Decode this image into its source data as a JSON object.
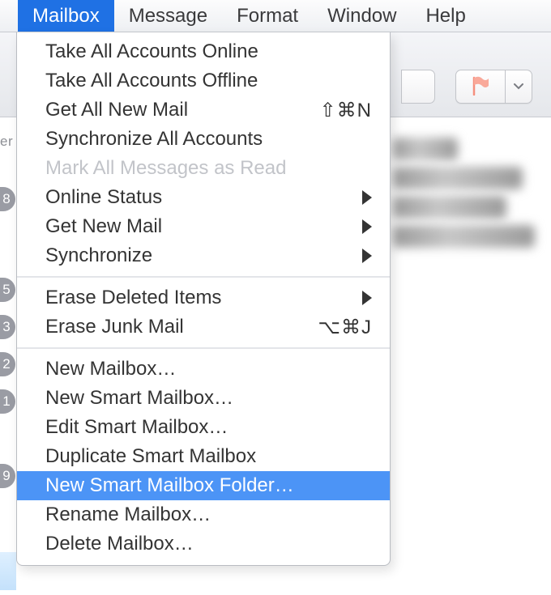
{
  "menubar": {
    "items": [
      {
        "label": "Mailbox",
        "active": true
      },
      {
        "label": "Message",
        "active": false
      },
      {
        "label": "Format",
        "active": false
      },
      {
        "label": "Window",
        "active": false
      },
      {
        "label": "Help",
        "active": false
      }
    ]
  },
  "dropdown": {
    "items": [
      {
        "type": "item",
        "label": "Take All Accounts Online"
      },
      {
        "type": "item",
        "label": "Take All Accounts Offline"
      },
      {
        "type": "item",
        "label": "Get All New Mail",
        "shortcut": "⇧⌘N"
      },
      {
        "type": "item",
        "label": "Synchronize All Accounts"
      },
      {
        "type": "item",
        "label": "Mark All Messages as Read",
        "disabled": true
      },
      {
        "type": "item",
        "label": "Online Status",
        "submenu": true
      },
      {
        "type": "item",
        "label": "Get New Mail",
        "submenu": true
      },
      {
        "type": "item",
        "label": "Synchronize",
        "submenu": true
      },
      {
        "type": "sep"
      },
      {
        "type": "item",
        "label": "Erase Deleted Items",
        "submenu": true
      },
      {
        "type": "item",
        "label": "Erase Junk Mail",
        "shortcut": "⌥⌘J"
      },
      {
        "type": "sep"
      },
      {
        "type": "item",
        "label": "New Mailbox…"
      },
      {
        "type": "item",
        "label": "New Smart Mailbox…"
      },
      {
        "type": "item",
        "label": "Edit Smart Mailbox…"
      },
      {
        "type": "item",
        "label": "Duplicate Smart Mailbox"
      },
      {
        "type": "item",
        "label": "New Smart Mailbox Folder…",
        "highlight": true
      },
      {
        "type": "item",
        "label": "Rename Mailbox…"
      },
      {
        "type": "item",
        "label": "Delete Mailbox…"
      }
    ]
  },
  "sidebar": {
    "header_peek": "er",
    "badges": [
      "8",
      "5",
      "3",
      "2",
      "1",
      "9"
    ]
  },
  "toolbar": {
    "flag_color": "#f58f7e"
  }
}
